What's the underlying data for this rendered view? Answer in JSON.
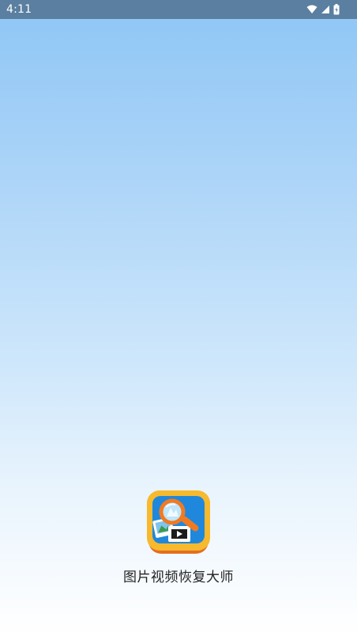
{
  "status_bar": {
    "time": "4:11",
    "icons": [
      "wifi-icon",
      "cellular-signal-icon",
      "battery-charging-icon"
    ]
  },
  "splash": {
    "app_name": "图片视频恢复大师",
    "app_icon": "photo-video-recovery-magnifier-icon"
  },
  "colors": {
    "status_bar_bg": "#5a7fa0",
    "gradient_top": "#8ec6f6",
    "gradient_bottom": "#ffffff",
    "icon_outer": "#f7b92d",
    "icon_inner": "#1f88dd",
    "magnifier": "#f07a22"
  }
}
